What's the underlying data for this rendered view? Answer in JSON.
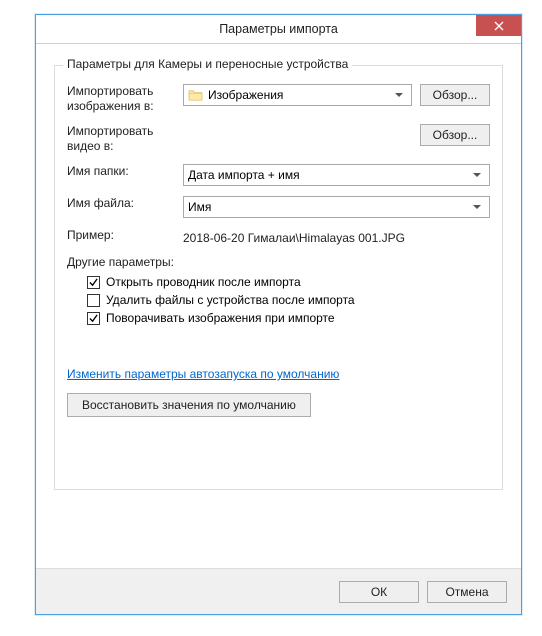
{
  "window": {
    "title": "Параметры импорта"
  },
  "group": {
    "legend": "Параметры для Камеры и переносные устройства"
  },
  "rows": {
    "import_images_label": "Импортировать изображения в:",
    "import_images_value": "Изображения",
    "import_video_label": "Импортировать видео в:",
    "folder_name_label": "Имя папки:",
    "folder_name_value": "Дата импорта + имя",
    "file_name_label": "Имя файла:",
    "file_name_value": "Имя",
    "example_label": "Пример:",
    "example_value": "2018-06-20 Гималаи\\Himalayas 001.JPG"
  },
  "browse": "Обзор...",
  "other_label": "Другие параметры:",
  "checks": {
    "open_explorer": "Открыть проводник после импорта",
    "delete_files": "Удалить файлы с устройства после импорта",
    "rotate": "Поворачивать изображения при импорте"
  },
  "link": "Изменить параметры автозапуска по умолчанию",
  "restore_btn": "Восстановить значения по умолчанию",
  "footer": {
    "ok": "ОК",
    "cancel": "Отмена"
  }
}
